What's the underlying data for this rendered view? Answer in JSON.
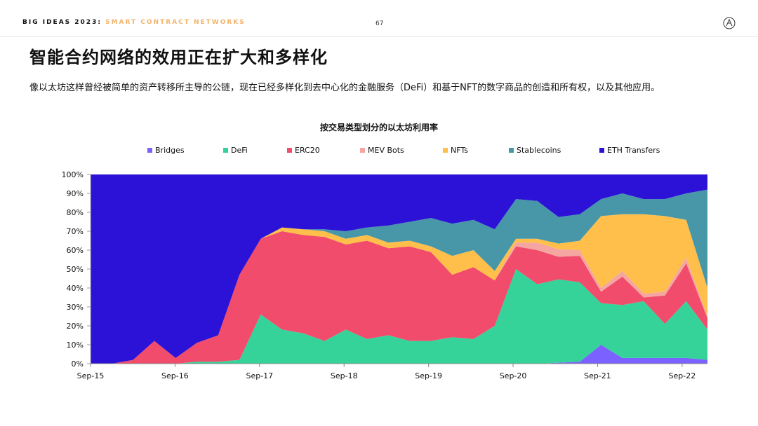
{
  "header": {
    "brand": "BIG IDEAS 2023",
    "brand_sep": ":",
    "section": "SMART CONTRACT NETWORKS",
    "page_number": "67"
  },
  "title": "智能合约网络的效用正在扩大和多样化",
  "subtitle": "像以太坊这样曾经被简单的资产转移所主导的公链，现在已经多样化到去中心化的金融服务（DeFi）和基于NFT的数字商品的创造和所有权，以及其他应用。",
  "colors": {
    "Bridges": "#7b61ff",
    "DeFi": "#35d39a",
    "ERC20": "#f14c6b",
    "MEV Bots": "#f5a6a0",
    "NFTs": "#ffbf4a",
    "Stablecoins": "#4797a8",
    "ETH Transfers": "#2c12d7"
  },
  "chart_data": {
    "type": "area",
    "title": "按交易类型划分的以太坊利用率",
    "x_ticks": [
      "Sep-15",
      "Sep-16",
      "Sep-17",
      "Sep-18",
      "Sep-19",
      "Sep-20",
      "Sep-21",
      "Sep-22"
    ],
    "y_ticks": [
      "0%",
      "10%",
      "20%",
      "30%",
      "40%",
      "50%",
      "60%",
      "70%",
      "80%",
      "90%",
      "100%"
    ],
    "ylim": [
      0,
      100
    ],
    "legend": [
      "Bridges",
      "DeFi",
      "ERC20",
      "MEV Bots",
      "NFTs",
      "Stablecoins",
      "ETH Transfers"
    ],
    "x": [
      "Sep-15",
      "Dec-15",
      "Mar-16",
      "Jun-16",
      "Sep-16",
      "Dec-16",
      "Mar-17",
      "Jun-17",
      "Sep-17",
      "Dec-17",
      "Mar-18",
      "Jun-18",
      "Sep-18",
      "Dec-18",
      "Mar-19",
      "Jun-19",
      "Sep-19",
      "Dec-19",
      "Mar-20",
      "Jun-20",
      "Sep-20",
      "Dec-20",
      "Mar-21",
      "Jun-21",
      "Sep-21",
      "Dec-21",
      "Mar-22",
      "Jun-22",
      "Sep-22",
      "Nov-22"
    ],
    "series": [
      {
        "name": "Bridges",
        "values": [
          0,
          0,
          0,
          0,
          0,
          0,
          0,
          0,
          0,
          0,
          0,
          0,
          0,
          0,
          0,
          0,
          0,
          0,
          0,
          0,
          0,
          0,
          0.5,
          1,
          10,
          3,
          3,
          3,
          3,
          2
        ]
      },
      {
        "name": "DeFi",
        "values": [
          0,
          0,
          0,
          0,
          0,
          1,
          1,
          2,
          26,
          18,
          16,
          12,
          18,
          13,
          15,
          12,
          12,
          14,
          13,
          20,
          50,
          42,
          44,
          42,
          22,
          28,
          30,
          18,
          30,
          16
        ]
      },
      {
        "name": "ERC20",
        "values": [
          0,
          0,
          2,
          12,
          3,
          10,
          14,
          45,
          40,
          52,
          52,
          55,
          45,
          52,
          46,
          50,
          47,
          33,
          38,
          24,
          12,
          18,
          12,
          14,
          6,
          15,
          2,
          15,
          20,
          6
        ]
      },
      {
        "name": "MEV Bots",
        "values": [
          0,
          0,
          0,
          0,
          0,
          0,
          0,
          0,
          0,
          0,
          0,
          0,
          0,
          0,
          0,
          0,
          0,
          0,
          0,
          0,
          2,
          4,
          4,
          3,
          2,
          3,
          2,
          2,
          3,
          1
        ]
      },
      {
        "name": "NFTs",
        "values": [
          0,
          0,
          0,
          0,
          0,
          0,
          0,
          0,
          0,
          2,
          3,
          3,
          3,
          3,
          3,
          3,
          3,
          10,
          9,
          5,
          2,
          2,
          3,
          5,
          38,
          30,
          42,
          40,
          20,
          15
        ]
      },
      {
        "name": "Stablecoins",
        "values": [
          0,
          0,
          0,
          0,
          0,
          0,
          0,
          0,
          0,
          0,
          0,
          1,
          4,
          4,
          9,
          10,
          15,
          17,
          16,
          22,
          21,
          20,
          14,
          14,
          9,
          11,
          8,
          9,
          14,
          52
        ]
      },
      {
        "name": "ETH Transfers",
        "values": [
          100,
          100,
          98,
          88,
          97,
          89,
          85,
          53,
          34,
          28,
          29,
          29,
          30,
          28,
          27,
          25,
          23,
          26,
          24,
          29,
          13,
          14,
          22.5,
          21,
          13,
          10,
          13,
          13,
          10,
          8
        ]
      }
    ]
  }
}
